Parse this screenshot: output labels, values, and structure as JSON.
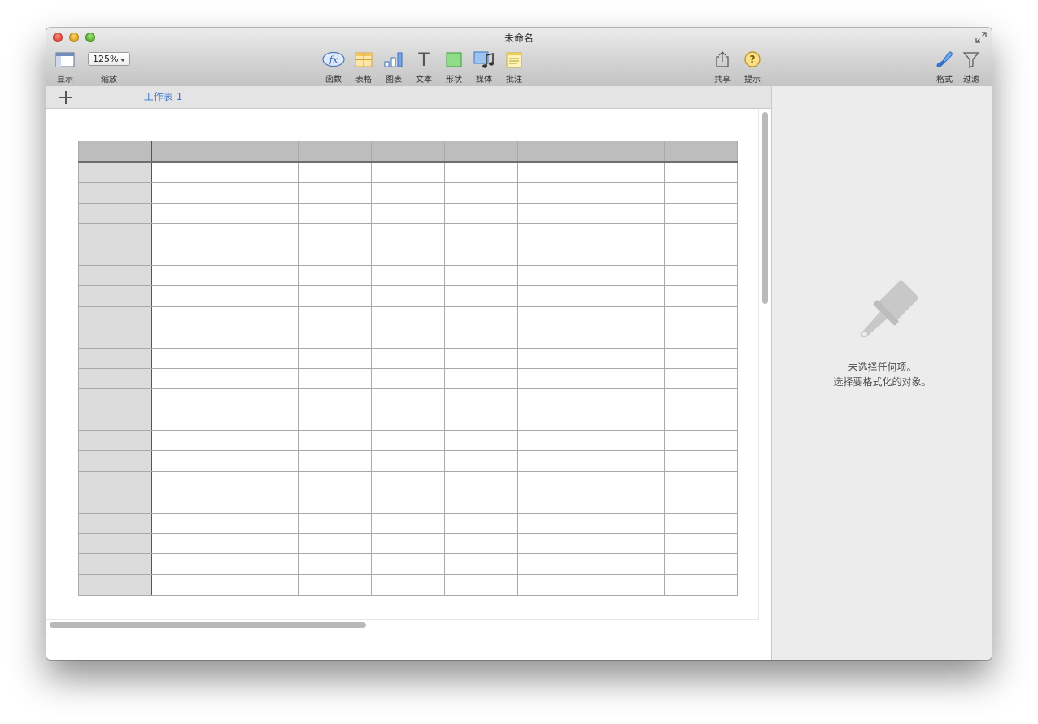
{
  "window": {
    "title": "未命名"
  },
  "toolbar": {
    "view_label": "显示",
    "zoom_value": "125%",
    "zoom_label": "缩放",
    "formula_label": "函数",
    "formula_glyph": "fx",
    "table_label": "表格",
    "chart_label": "图表",
    "text_label": "文本",
    "text_glyph": "T",
    "shape_label": "形状",
    "media_label": "媒体",
    "comment_label": "批注",
    "share_label": "共享",
    "tips_label": "提示",
    "tips_glyph": "?",
    "format_label": "格式",
    "filter_label": "过滤"
  },
  "sheet_tabs": [
    {
      "label": "工作表 1",
      "selected": true
    }
  ],
  "table": {
    "columns": 9,
    "header_rows": 1,
    "body_rows": 21
  },
  "inspector": {
    "line1": "未选择任何项。",
    "line2": "选择要格式化的对象。"
  },
  "colors": {
    "accent": "#3c76d0",
    "table_header": "#bdbdbd",
    "row_header": "#dcdcdc",
    "inspector_bg": "#ececec"
  },
  "icons": [
    "view-icon",
    "formula-icon",
    "table-icon",
    "chart-icon",
    "text-icon",
    "shape-icon",
    "media-icon",
    "comment-icon",
    "share-icon",
    "tips-icon",
    "format-brush-icon",
    "filter-icon",
    "paintbrush-icon",
    "fullscreen-icon",
    "add-sheet-icon"
  ]
}
